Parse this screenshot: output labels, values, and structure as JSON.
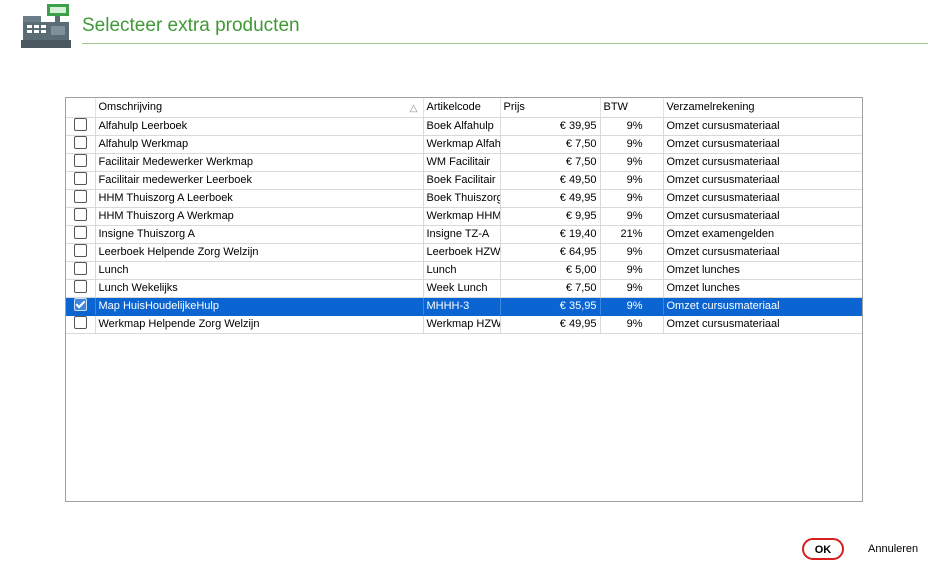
{
  "header": {
    "title": "Selecteer extra producten"
  },
  "grid": {
    "columns": [
      "Omschrijving",
      "Artikelcode",
      "Prijs",
      "BTW",
      "Verzamelrekening"
    ],
    "rows": [
      {
        "checked": false,
        "selected": false,
        "omschrijving": "Alfahulp Leerboek",
        "artikelcode": "Boek Alfahulp",
        "prijs": "€ 39,95",
        "btw": "9%",
        "verzamelrekening": "Omzet cursusmateriaal"
      },
      {
        "checked": false,
        "selected": false,
        "omschrijving": "Alfahulp Werkmap",
        "artikelcode": "Werkmap Alfah",
        "prijs": "€ 7,50",
        "btw": "9%",
        "verzamelrekening": "Omzet cursusmateriaal"
      },
      {
        "checked": false,
        "selected": false,
        "omschrijving": "Facilitair Medewerker Werkmap",
        "artikelcode": "WM Facilitair",
        "prijs": "€ 7,50",
        "btw": "9%",
        "verzamelrekening": "Omzet cursusmateriaal"
      },
      {
        "checked": false,
        "selected": false,
        "omschrijving": "Facilitair medewerker Leerboek",
        "artikelcode": "Boek Facilitair",
        "prijs": "€ 49,50",
        "btw": "9%",
        "verzamelrekening": "Omzet cursusmateriaal"
      },
      {
        "checked": false,
        "selected": false,
        "omschrijving": "HHM Thuiszorg A Leerboek",
        "artikelcode": "Boek Thuiszorg",
        "prijs": "€ 49,95",
        "btw": "9%",
        "verzamelrekening": "Omzet cursusmateriaal"
      },
      {
        "checked": false,
        "selected": false,
        "omschrijving": "HHM Thuiszorg A Werkmap",
        "artikelcode": "Werkmap HHM",
        "prijs": "€ 9,95",
        "btw": "9%",
        "verzamelrekening": "Omzet cursusmateriaal"
      },
      {
        "checked": false,
        "selected": false,
        "omschrijving": "Insigne Thuiszorg A",
        "artikelcode": "Insigne TZ-A",
        "prijs": "€ 19,40",
        "btw": "21%",
        "verzamelrekening": "Omzet examengelden"
      },
      {
        "checked": false,
        "selected": false,
        "omschrijving": "Leerboek Helpende Zorg Welzijn",
        "artikelcode": "Leerboek HZW",
        "prijs": "€ 64,95",
        "btw": "9%",
        "verzamelrekening": "Omzet cursusmateriaal"
      },
      {
        "checked": false,
        "selected": false,
        "omschrijving": "Lunch",
        "artikelcode": "Lunch",
        "prijs": "€ 5,00",
        "btw": "9%",
        "verzamelrekening": "Omzet lunches"
      },
      {
        "checked": false,
        "selected": false,
        "omschrijving": "Lunch Wekelijks",
        "artikelcode": "Week Lunch",
        "prijs": "€ 7,50",
        "btw": "9%",
        "verzamelrekening": "Omzet lunches"
      },
      {
        "checked": true,
        "selected": true,
        "omschrijving": "Map HuisHoudelijkeHulp",
        "artikelcode": "MHHH-3",
        "prijs": "€ 35,95",
        "btw": "9%",
        "verzamelrekening": "Omzet cursusmateriaal"
      },
      {
        "checked": false,
        "selected": false,
        "omschrijving": "Werkmap Helpende Zorg Welzijn",
        "artikelcode": "Werkmap HZW",
        "prijs": "€ 49,95",
        "btw": "9%",
        "verzamelrekening": "Omzet cursusmateriaal"
      }
    ]
  },
  "footer": {
    "ok_label": "OK",
    "cancel_label": "Annuleren"
  },
  "colors": {
    "title": "#3f9a35",
    "selection": "#0a64d2",
    "ok_border": "#d81e1e"
  }
}
